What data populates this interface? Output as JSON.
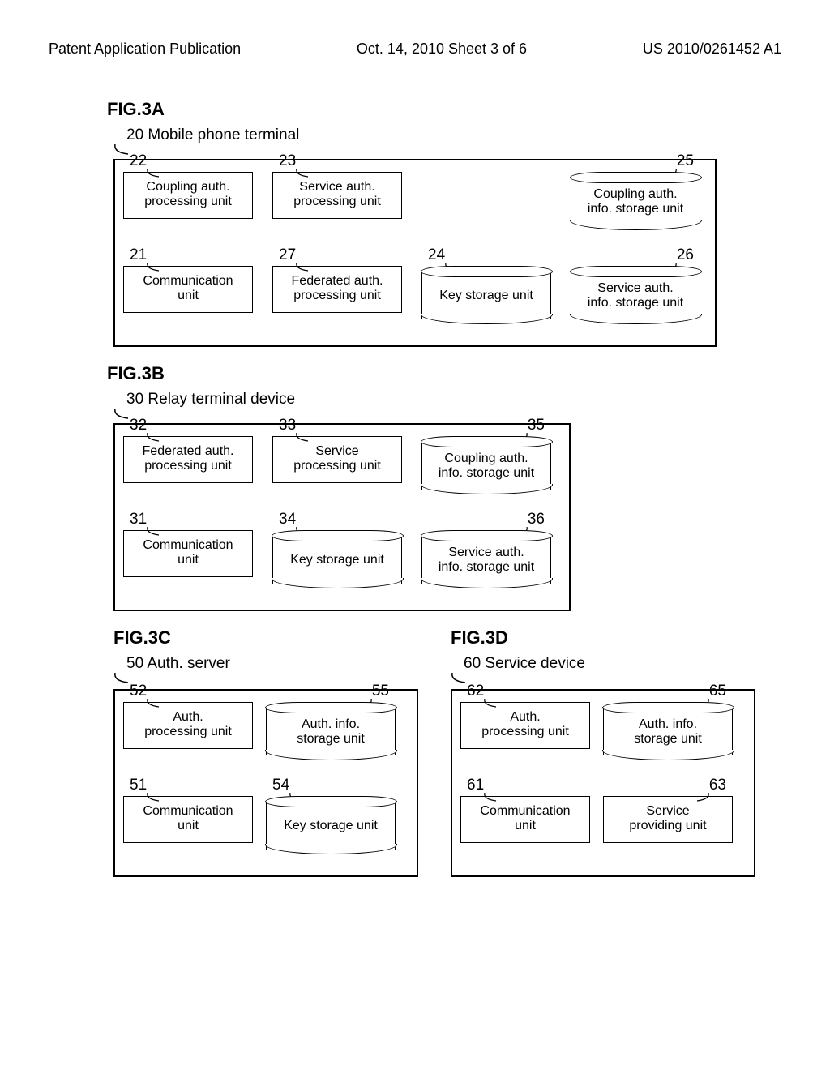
{
  "header": {
    "left": "Patent Application Publication",
    "center": "Oct. 14, 2010  Sheet 3 of 6",
    "right": "US 2010/0261452 A1"
  },
  "figA": {
    "label": "FIG.3A",
    "device_num": "20",
    "device_name": "Mobile phone terminal",
    "units": {
      "u22": {
        "num": "22",
        "text1": "Coupling auth.",
        "text2": "processing unit",
        "type": "rect"
      },
      "u23": {
        "num": "23",
        "text1": "Service auth.",
        "text2": "processing unit",
        "type": "rect"
      },
      "u25": {
        "num": "25",
        "text1": "Coupling auth.",
        "text2": "info. storage unit",
        "type": "cyl"
      },
      "u21": {
        "num": "21",
        "text1": "Communication",
        "text2": "unit",
        "type": "rect"
      },
      "u27": {
        "num": "27",
        "text1": "Federated auth.",
        "text2": "processing unit",
        "type": "rect"
      },
      "u24": {
        "num": "24",
        "text1": "Key storage unit",
        "text2": "",
        "type": "cyl"
      },
      "u26": {
        "num": "26",
        "text1": "Service auth.",
        "text2": "info. storage unit",
        "type": "cyl"
      }
    }
  },
  "figB": {
    "label": "FIG.3B",
    "device_num": "30",
    "device_name": "Relay terminal device",
    "units": {
      "u32": {
        "num": "32",
        "text1": "Federated auth.",
        "text2": "processing unit",
        "type": "rect"
      },
      "u33": {
        "num": "33",
        "text1": "Service",
        "text2": "processing unit",
        "type": "rect"
      },
      "u35": {
        "num": "35",
        "text1": "Coupling auth.",
        "text2": "info. storage unit",
        "type": "cyl"
      },
      "u31": {
        "num": "31",
        "text1": "Communication",
        "text2": "unit",
        "type": "rect"
      },
      "u34": {
        "num": "34",
        "text1": "Key storage unit",
        "text2": "",
        "type": "cyl"
      },
      "u36": {
        "num": "36",
        "text1": "Service auth.",
        "text2": "info. storage unit",
        "type": "cyl"
      }
    }
  },
  "figC": {
    "label": "FIG.3C",
    "device_num": "50",
    "device_name": "Auth. server",
    "units": {
      "u52": {
        "num": "52",
        "text1": "Auth.",
        "text2": "processing unit",
        "type": "rect"
      },
      "u55": {
        "num": "55",
        "text1": "Auth. info.",
        "text2": "storage unit",
        "type": "cyl"
      },
      "u51": {
        "num": "51",
        "text1": "Communication",
        "text2": "unit",
        "type": "rect"
      },
      "u54": {
        "num": "54",
        "text1": "Key storage unit",
        "text2": "",
        "type": "cyl"
      }
    }
  },
  "figD": {
    "label": "FIG.3D",
    "device_num": "60",
    "device_name": "Service device",
    "units": {
      "u62": {
        "num": "62",
        "text1": "Auth.",
        "text2": "processing unit",
        "type": "rect"
      },
      "u65": {
        "num": "65",
        "text1": "Auth. info.",
        "text2": "storage unit",
        "type": "cyl"
      },
      "u61": {
        "num": "61",
        "text1": "Communication",
        "text2": "unit",
        "type": "rect"
      },
      "u63": {
        "num": "63",
        "text1": "Service",
        "text2": "providing unit",
        "type": "rect"
      }
    }
  }
}
